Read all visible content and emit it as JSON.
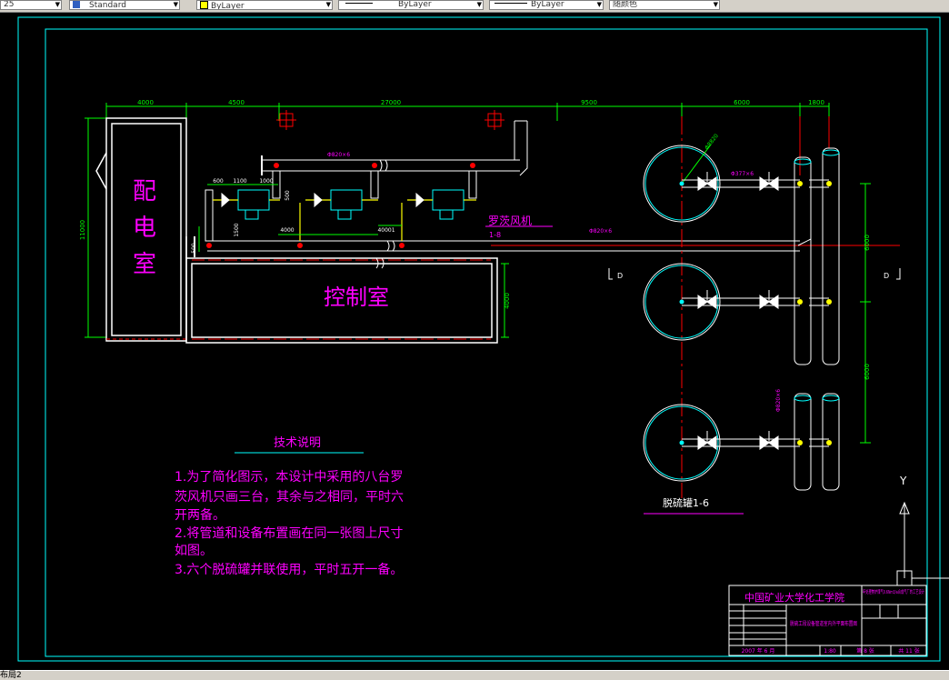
{
  "toolbar": {
    "left_field": "25",
    "style_value": "Standard",
    "layer_value": "ByLayer",
    "linetype_value": "ByLayer",
    "lineweight_value": "ByLayer",
    "color_value": "随颜色"
  },
  "drawing": {
    "room_power": [
      "配",
      "电",
      "室"
    ],
    "room_control": "控制室",
    "fan_label": "罗茨风机",
    "fan_sub": "1-8",
    "tank_label": "脱硫罐1-6",
    "notes_title": "技术说明",
    "notes": [
      "1.为了简化图示，本设计中采用的八台罗",
      "茨风机只画三台，其余与之相同，平时六",
      "开两备。",
      "2.将管道和设备布置画在同一张图上尺寸",
      "如图。",
      "3.六个脱硫罐并联使用，平时五开一备。"
    ],
    "dims": {
      "d4000": "4000",
      "d4500": "4500",
      "d27000": "27000",
      "d9500": "9500",
      "d6000": "6000",
      "d1800": "1800",
      "d11000": "11000",
      "d600": "600",
      "d1100": "1100",
      "d1000": "1000",
      "d500": "500",
      "d1500": "1500",
      "d4000b": "4000",
      "d40001": "40001",
      "d4000c": "4000",
      "d6000b": "6000",
      "d6000c": "6000",
      "pipe1": "Φ820×6",
      "pipe2": "Φ820×6",
      "pipe3": "Φ377×6",
      "pipe4": "Φ820×6",
      "tank_dia": "Φ8820"
    },
    "section_marks": [
      "D",
      "D"
    ],
    "axis_y": "Y",
    "title_block": {
      "school": "中国矿业大学化工学院",
      "project": "年处理焦炉煤气0.6Nm3/a合成气厂的工艺设计",
      "drawing_name": "脱硫工段设备管道室内外平面布置图",
      "date": "2007 年 6 月",
      "scale": "1:80",
      "sheet": "第 8 张",
      "total": "共 11 张"
    }
  },
  "status": {
    "layout_tab": "布局2"
  },
  "colors": {
    "background": "#000000",
    "frame": "#00ffff",
    "magenta": "#ff00ff",
    "green": "#00ff00",
    "white": "#ffffff",
    "red": "#ff0000",
    "yellow": "#ffff00"
  }
}
